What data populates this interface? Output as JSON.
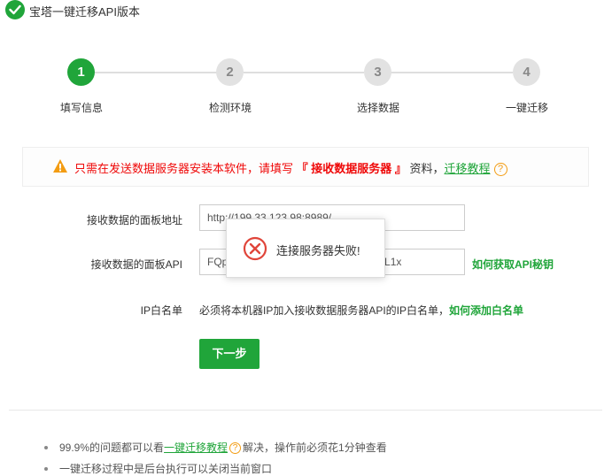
{
  "window": {
    "title": "宝塔一键迁移API版本",
    "icon": "check-circle-icon"
  },
  "steps": [
    {
      "num": "1",
      "label": "填写信息",
      "active": true
    },
    {
      "num": "2",
      "label": "检测环境",
      "active": false
    },
    {
      "num": "3",
      "label": "选择数据",
      "active": false
    },
    {
      "num": "4",
      "label": "一键迁移",
      "active": false
    }
  ],
  "notice": {
    "prefix": "只需在发送数据服务器安装本软件，请填写",
    "highlight": "『 接收数据服务器 』",
    "suffix": "资料，",
    "link": "迁移教程",
    "help": "?",
    "icon": "warning-icon"
  },
  "form": {
    "panel_url_label": "接收数据的面板地址",
    "panel_url_value": "http://199.33.123.98:8989/",
    "panel_api_label": "接收数据的面板API",
    "panel_api_value": "FQp                                              EwdL1x",
    "api_link": "如何获取API秘钥",
    "ip_label": "IP白名单",
    "ip_text": "必须将本机器IP加入接收数据服务器API的IP白名单，",
    "ip_link": "如何添加白名单",
    "next_button": "下一步"
  },
  "tips": [
    {
      "prefix": "99.9%的问题都可以看",
      "link": "一键迁移教程",
      "help": "?",
      "suffix": "解决，操作前必须花1分钟查看"
    },
    {
      "prefix": "一键迁移过程中是后台执行可以关闭当前窗口"
    }
  ],
  "toast": {
    "message": "连接服务器失败!",
    "icon": "error-x-icon"
  },
  "colors": {
    "brand": "#20a53a",
    "warning": "#ef0808",
    "help": "#f39c12",
    "inactive_step": "#e2e2e2"
  }
}
